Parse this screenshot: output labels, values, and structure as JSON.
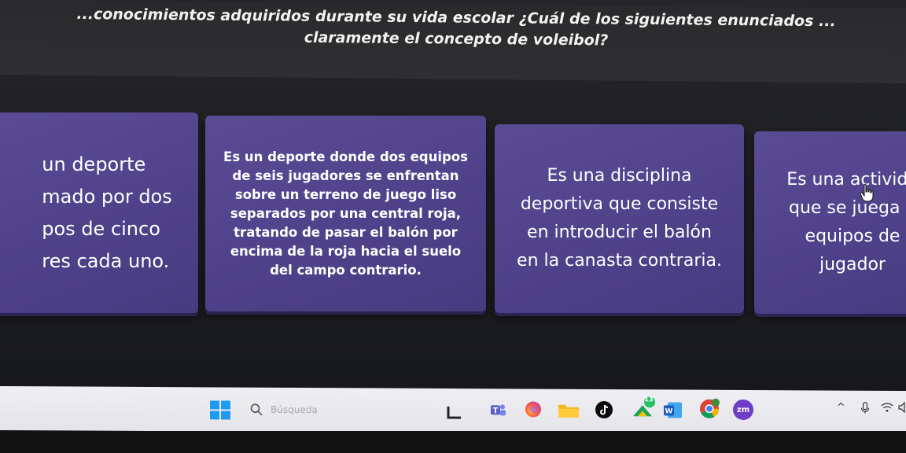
{
  "question": {
    "text": "...conocimientos adquiridos durante su vida escolar ¿Cuál de los siguientes enunciados ...\nclaramente el concepto de voleibol?"
  },
  "answers": [
    {
      "text": "un deporte\nmado por dos\npos de cinco\nres cada uno."
    },
    {
      "text": "Es un deporte donde dos equipos\nde seis jugadores se enfrentan\nsobre un terreno de juego liso\nseparados por una central roja,\ntratando de pasar el balón por\nencima de la roja hacia el suelo\ndel campo contrario."
    },
    {
      "text": "Es una disciplina\ndeportiva que consiste\nen introducir el balón\nen la canasta contraria."
    },
    {
      "text": "Es una activida\nque se juega e\nequipos de\njugador"
    }
  ],
  "taskbar": {
    "search_placeholder": "Búsqueda",
    "icons": [
      "windows-start-icon",
      "search-icon",
      "file-explorer-icon",
      "teams-icon",
      "firefox-icon",
      "folder-icon",
      "tiktok-icon",
      "whatsapp-icon",
      "word-icon",
      "chrome-icon",
      "zoom-icon"
    ],
    "badges": {
      "whatsapp": "13"
    },
    "zoom_label": "zm"
  },
  "colors": {
    "card": "#534592",
    "taskbar": "#ececf0",
    "background": "#1f2023"
  }
}
